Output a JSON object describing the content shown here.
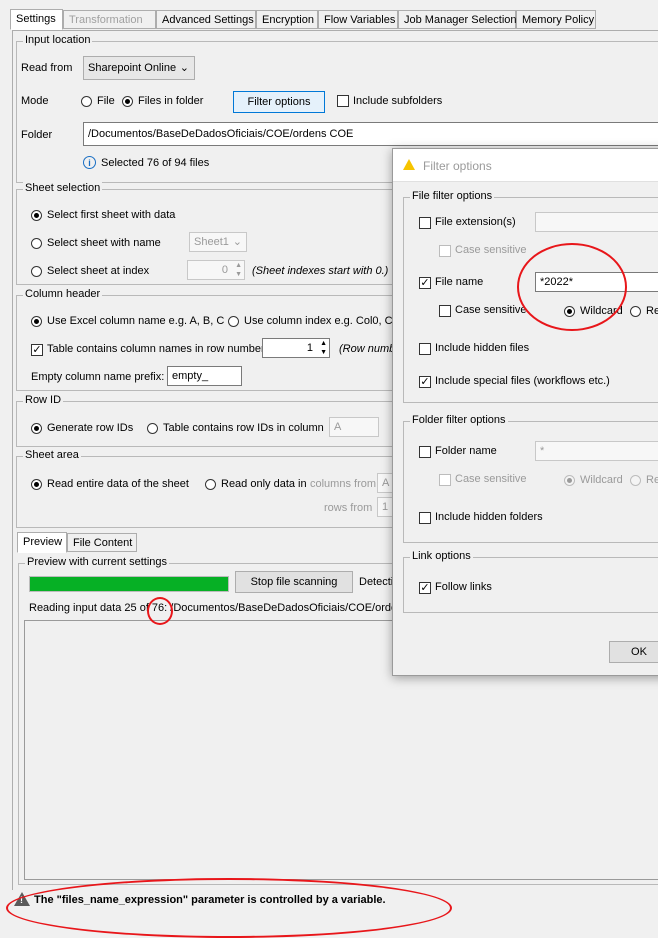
{
  "tabs": [
    "Settings",
    "Transformation",
    "Advanced Settings",
    "Encryption",
    "Flow Variables",
    "Job Manager Selection",
    "Memory Policy"
  ],
  "input_location": {
    "title": "Input location",
    "read_from_label": "Read from",
    "read_from_value": "Sharepoint Online",
    "mode_label": "Mode",
    "mode_file": "File",
    "mode_files_in_folder": "Files in folder",
    "filter_options_button": "Filter options",
    "include_subfolders": "Include subfolders",
    "folder_label": "Folder",
    "folder_value": "/Documentos/BaseDeDadosOficiais/COE/ordens COE",
    "selected_info": "Selected 76 of 94 files"
  },
  "sheet_selection": {
    "title": "Sheet selection",
    "first_sheet": "Select first sheet with data",
    "sheet_name": "Select sheet with name",
    "sheet_name_value": "Sheet1",
    "sheet_index": "Select sheet at index",
    "sheet_index_value": "0",
    "sheet_index_note": "(Sheet indexes start with 0.)"
  },
  "column_header": {
    "title": "Column header",
    "excel_names": "Use Excel column name e.g. A, B, C",
    "column_index": "Use column index e.g. Col0, Co",
    "table_contains": "Table contains column names in row number",
    "row_number_value": "1",
    "row_number_note": "(Row numbe",
    "empty_prefix_label": "Empty column name prefix:",
    "empty_prefix_value": "empty_"
  },
  "row_id": {
    "title": "Row ID",
    "generate": "Generate row IDs",
    "contains": "Table contains row IDs in column",
    "column_value": "A"
  },
  "sheet_area": {
    "title": "Sheet area",
    "entire": "Read entire data of the sheet",
    "only": "Read only data in",
    "columns_from": "columns from",
    "columns_value": "A",
    "rows_from": "rows from",
    "rows_value": "1"
  },
  "preview_tabs": [
    "Preview",
    "File Content"
  ],
  "preview": {
    "title": "Preview with current settings",
    "progress": 1.0,
    "stop_button": "Stop file scanning",
    "detecting": "Detectin",
    "reading": "Reading input data 25 of 76: /Documentos/BaseDeDadosOficiais/COE/ordens"
  },
  "status_message": "The \"files_name_expression\" parameter is controlled by a variable.",
  "filter_dialog": {
    "title": "Filter options",
    "file_filter": {
      "title": "File filter options",
      "file_extensions": "File extension(s)",
      "case_sensitive": "Case sensitive",
      "file_name": "File name",
      "file_name_value": "*2022*",
      "case_sensitive_2": "Case sensitive",
      "wildcard": "Wildcard",
      "regex_partial": "Re",
      "include_hidden_files": "Include hidden files",
      "include_special_files": "Include special files (workflows etc.)"
    },
    "folder_filter": {
      "title": "Folder filter options",
      "folder_name": "Folder name",
      "folder_name_value": "*",
      "case_sensitive": "Case sensitive",
      "wildcard": "Wildcard",
      "regex_partial": "Re",
      "include_hidden_folders": "Include hidden folders"
    },
    "link_options": {
      "title": "Link options",
      "follow_links": "Follow links"
    },
    "ok_button": "OK"
  },
  "colors": {
    "highlight": "#e8161a",
    "progress": "#06b025",
    "accent": "#0078d7"
  }
}
